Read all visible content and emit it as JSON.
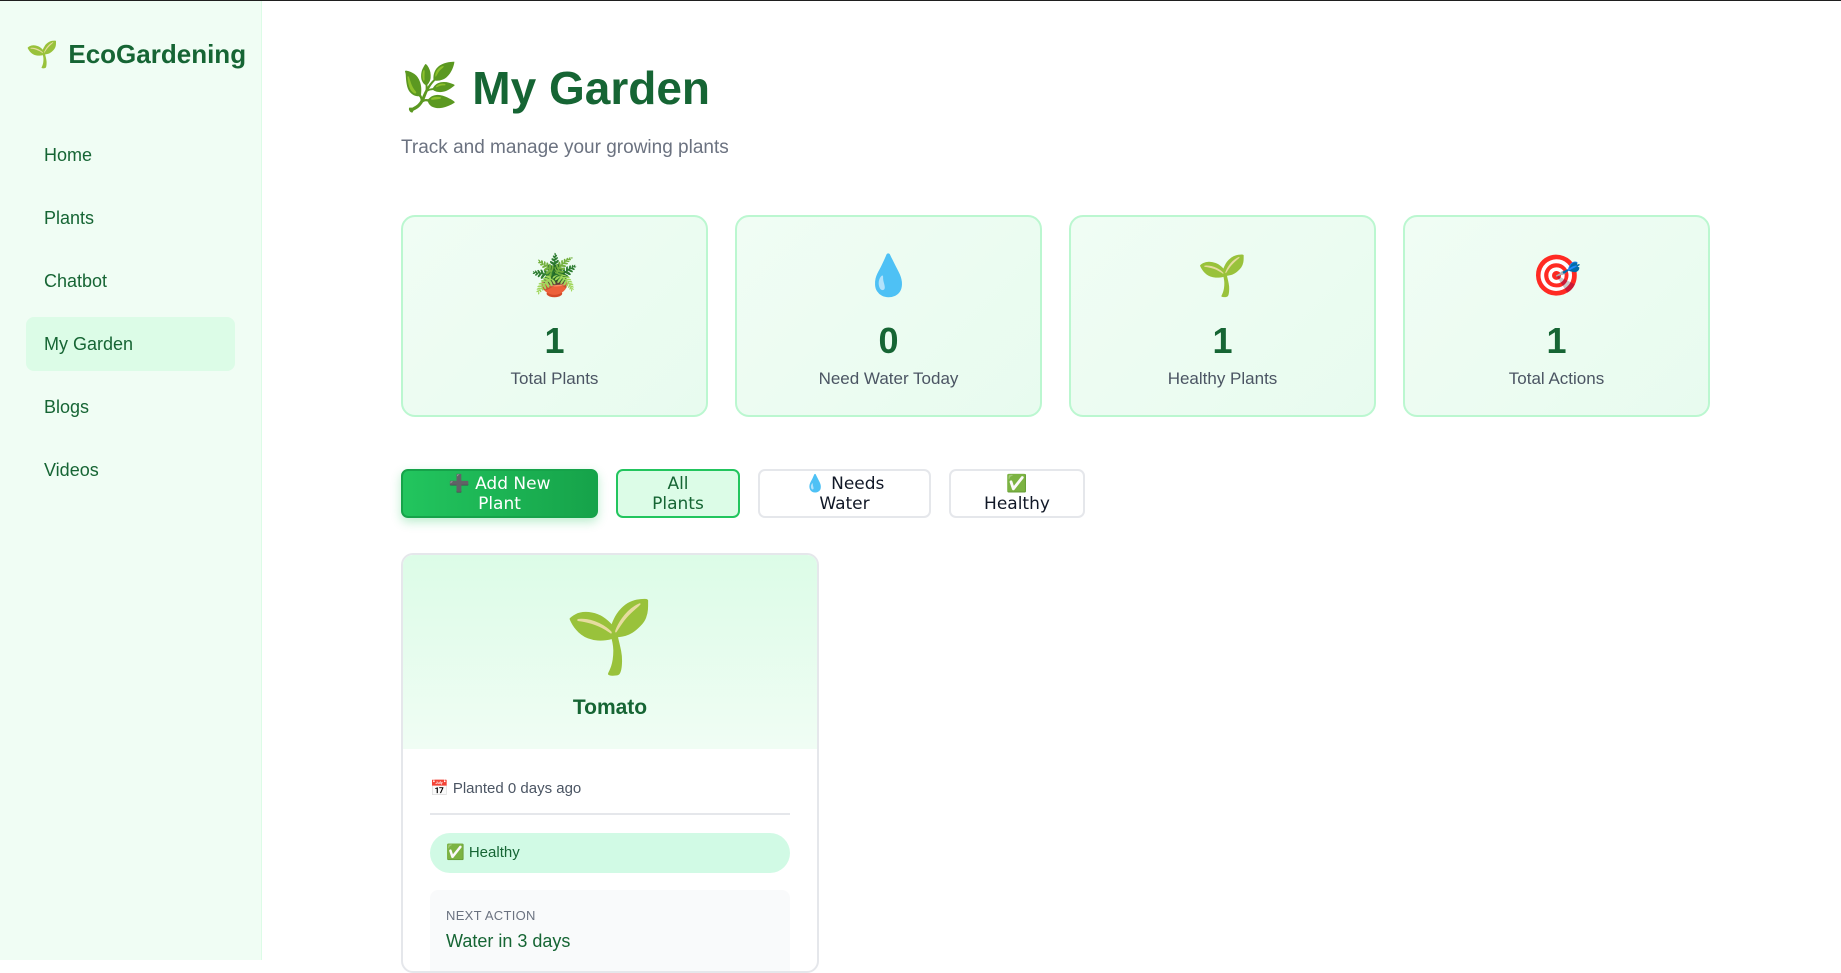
{
  "brand": {
    "icon": "🌱",
    "name": "EcoGardening"
  },
  "nav": [
    {
      "label": "Home",
      "active": false
    },
    {
      "label": "Plants",
      "active": false
    },
    {
      "label": "Chatbot",
      "active": false
    },
    {
      "label": "My Garden",
      "active": true
    },
    {
      "label": "Blogs",
      "active": false
    },
    {
      "label": "Videos",
      "active": false
    }
  ],
  "header": {
    "icon": "🌿",
    "title": "My Garden",
    "subtitle": "Track and manage your growing plants"
  },
  "stats": [
    {
      "icon": "🪴",
      "value": "1",
      "label": "Total Plants"
    },
    {
      "icon": "💧",
      "value": "0",
      "label": "Need Water Today"
    },
    {
      "icon": "🌱",
      "value": "1",
      "label": "Healthy Plants"
    },
    {
      "icon": "🎯",
      "value": "1",
      "label": "Total Actions"
    }
  ],
  "actions": {
    "add_label": "➕ Add New Plant",
    "filter_all": "All Plants",
    "filter_water": "💧 Needs Water",
    "filter_healthy": "✅ Healthy"
  },
  "plant": {
    "icon": "🌱",
    "name": "Tomato",
    "planted": "📅 Planted 0 days ago",
    "status": "✅ Healthy",
    "next_action_label": "NEXT ACTION",
    "next_action_value": "Water in 3 days"
  },
  "colors": {
    "brand_green": "#166534",
    "accent_green": "#22c55e",
    "sidebar_bg": "#f0fdf4"
  }
}
